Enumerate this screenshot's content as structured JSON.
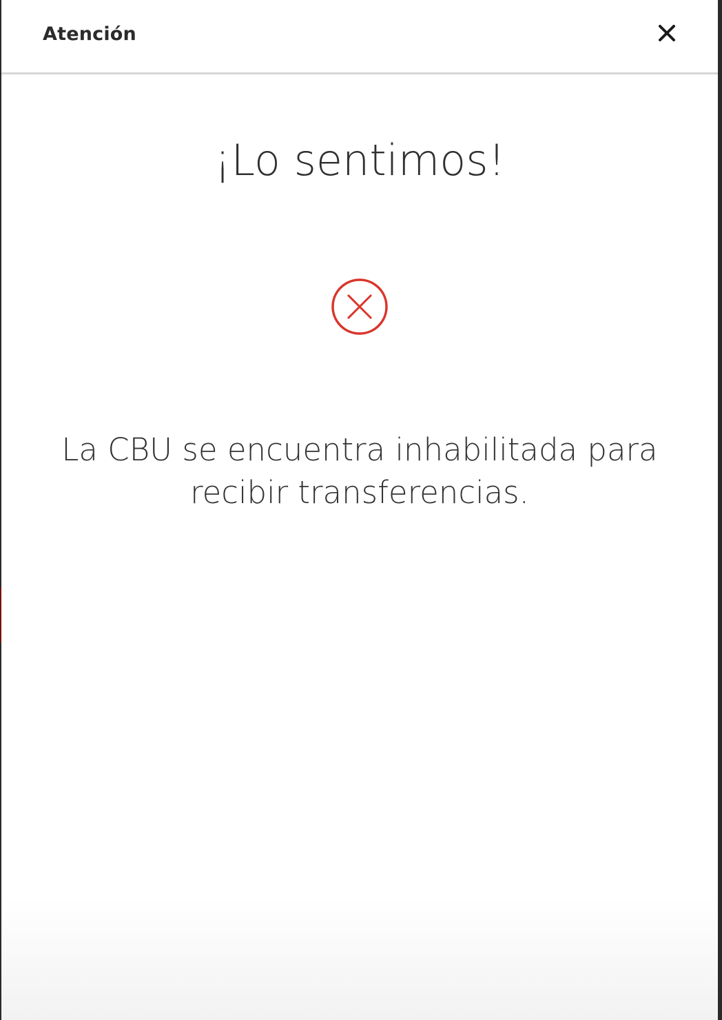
{
  "modal": {
    "title": "Atención",
    "close_icon": "close-icon",
    "heading": "¡Lo sentimos!",
    "status_icon": "error-circle-x-icon",
    "message": "La CBU se encuentra inhabilitada para recibir transferencias."
  },
  "colors": {
    "error": "#d9362b",
    "text": "#2f2f2f",
    "divider": "#d6d6d6"
  }
}
